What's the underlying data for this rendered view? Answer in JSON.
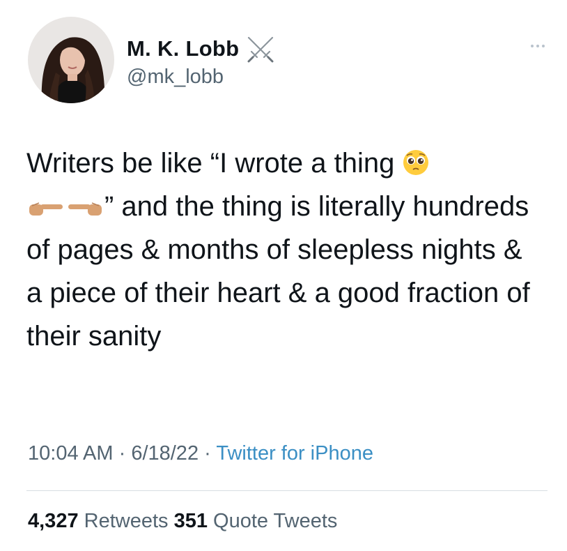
{
  "author": {
    "display_name": "M. K. Lobb",
    "name_emoji": "crossed-swords-icon",
    "handle": "@mk_lobb"
  },
  "tweet": {
    "text_part1": "Writers be like “I wrote a thing ",
    "text_part2": "” and the thing is literally hundreds of pages & months of sleepless nights & a piece of their heart & a good fraction of their sanity",
    "emojis": [
      "pleading-face-icon",
      "pointing-right-icon",
      "pointing-left-icon"
    ]
  },
  "meta": {
    "time": "10:04 AM",
    "separator1": " · ",
    "date": "6/18/22",
    "separator2": " · ",
    "source": "Twitter for iPhone"
  },
  "stats": {
    "retweets_count": "4,327",
    "retweets_label": " Retweets ",
    "quotes_count": "351",
    "quotes_label": " Quote Tweets"
  },
  "colors": {
    "text": "#0f1419",
    "secondary": "#536471",
    "link": "#3b8fc4",
    "divider": "#d7dde2"
  }
}
